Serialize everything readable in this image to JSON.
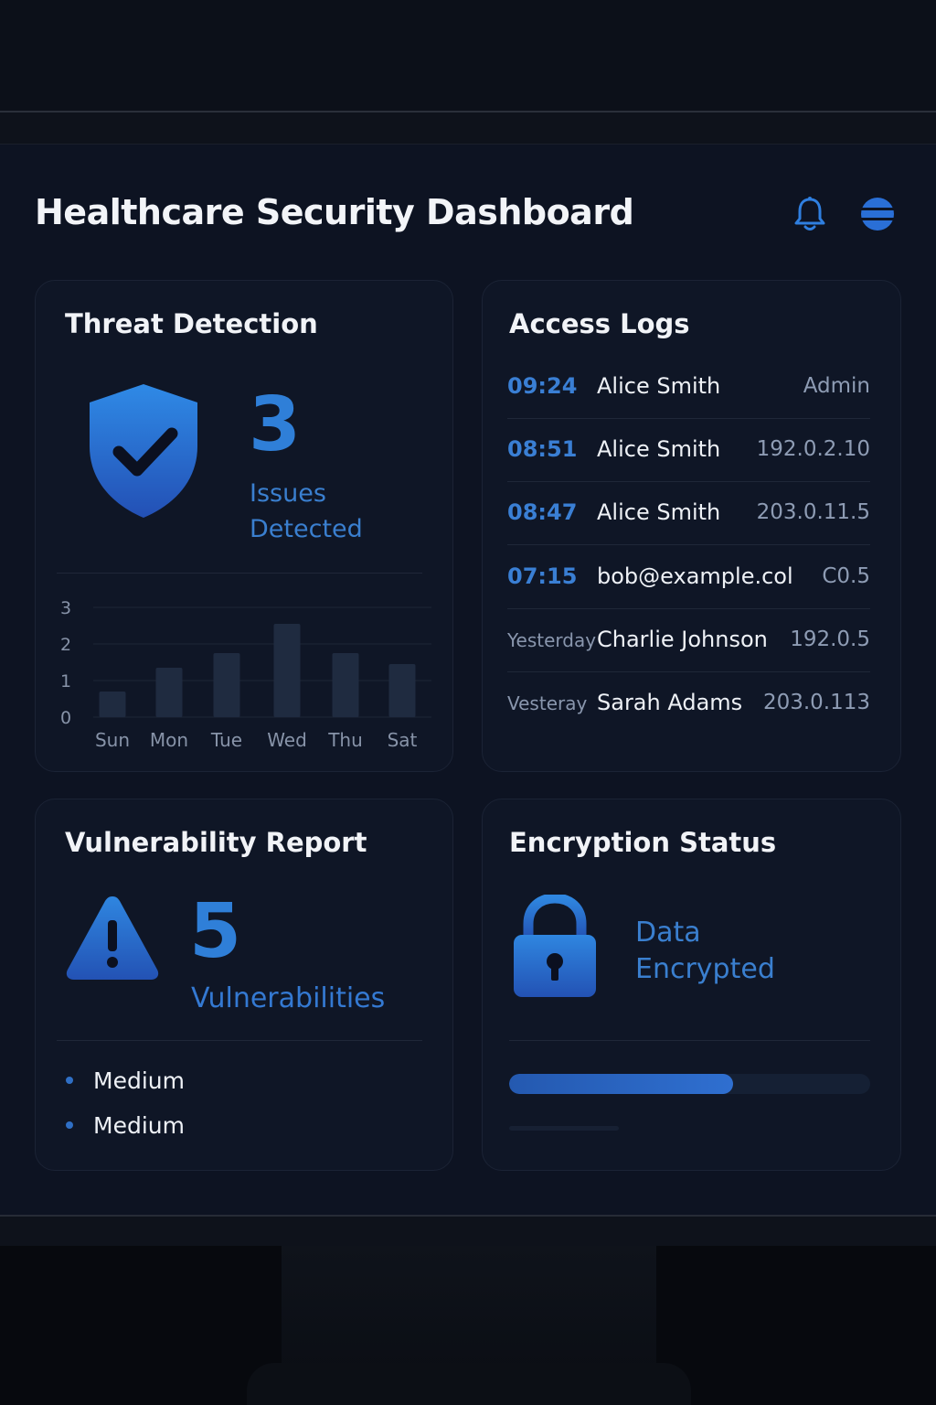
{
  "header": {
    "title": "Healthcare Security Dashboard",
    "icons": [
      "bell-icon",
      "menu-icon"
    ]
  },
  "threat_detection": {
    "title": "Threat Detection",
    "count": "3",
    "label_line1": "Issues",
    "label_line2": "Detected",
    "icon": "shield-check-icon"
  },
  "chart_data": {
    "type": "bar",
    "categories": [
      "Sun",
      "Mon",
      "Tue",
      "Wed",
      "Thu",
      "Sat"
    ],
    "values": [
      0.7,
      1.35,
      1.75,
      2.55,
      1.75,
      1.45
    ],
    "yticks": [
      "0",
      "1",
      "2",
      "3"
    ],
    "ylim": [
      0,
      3
    ],
    "grid": true,
    "title": "",
    "xlabel": "",
    "ylabel": ""
  },
  "access_logs": {
    "title": "Access Logs",
    "rows": [
      {
        "time": "09:24",
        "user": "Alice Smith",
        "detail": "Admin"
      },
      {
        "time": "08:51",
        "user": "Alice Smith",
        "detail": "192.0.2.10"
      },
      {
        "time": "08:47",
        "user": "Alice Smith",
        "detail": "203.0.11.5"
      },
      {
        "time": "07:15",
        "user": "bob@example.col",
        "detail": "C0.5"
      },
      {
        "time": "Yesterday",
        "user": "Charlie Johnson",
        "detail": "192.0.5"
      },
      {
        "time": "Vesteray",
        "user": "Sarah Adams",
        "detail": "203.0.113"
      }
    ]
  },
  "vulnerability_report": {
    "title": "Vulnerability Report",
    "count": "5",
    "label": "Vulnerabilities",
    "icon": "warning-icon",
    "items": [
      "Medium",
      "Medium"
    ]
  },
  "encryption_status": {
    "title": "Encryption Status",
    "label_line1": "Data",
    "label_line2": "Encrypted",
    "icon": "lock-icon",
    "progress": 0.62
  },
  "colors": {
    "accent": "#2f7fd8",
    "background": "#0d1322",
    "card": "#0f1626"
  }
}
